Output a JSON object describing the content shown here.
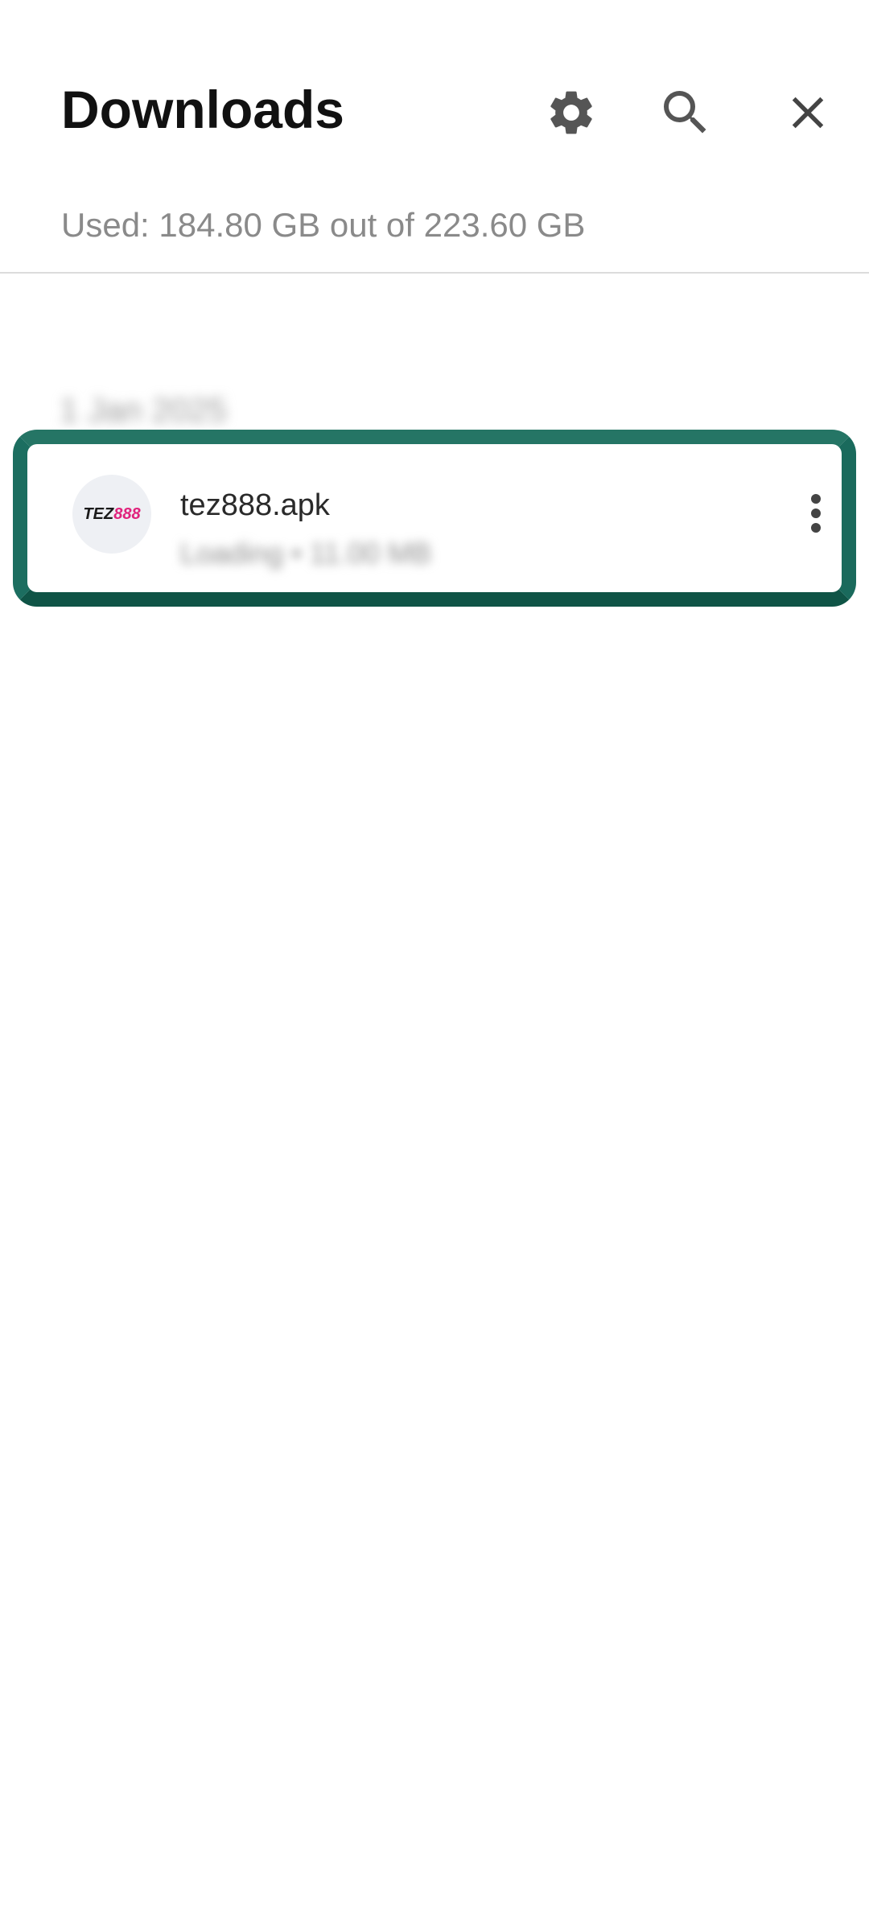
{
  "header": {
    "title": "Downloads",
    "storage_used": "Used: 184.80 GB out of 223.60 GB",
    "icons": [
      "gear-icon",
      "search-icon",
      "close-icon"
    ]
  },
  "downloads": {
    "groups": [
      {
        "date_label": "1 Jan 2025",
        "items": [
          {
            "thumb_text_dark": "TEZ",
            "thumb_text_accent": "888",
            "file_name": "tez888.apk",
            "meta": "Loading • 11.00 MB"
          }
        ]
      }
    ]
  },
  "colors": {
    "highlight_border": "#1d6b5f",
    "thumb_accent": "#e0237c",
    "title_text": "#111111",
    "secondary_text": "#8a8a8a"
  }
}
